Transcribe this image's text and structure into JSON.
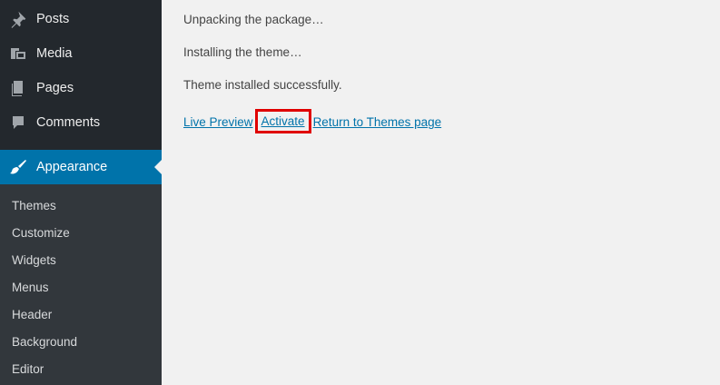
{
  "sidebar": {
    "items": [
      {
        "label": "Posts",
        "icon": "pin-icon"
      },
      {
        "label": "Media",
        "icon": "media-icon"
      },
      {
        "label": "Pages",
        "icon": "pages-icon"
      },
      {
        "label": "Comments",
        "icon": "comment-icon"
      },
      {
        "label": "Appearance",
        "icon": "brush-icon",
        "active": true
      }
    ],
    "submenu": [
      "Themes",
      "Customize",
      "Widgets",
      "Menus",
      "Header",
      "Background",
      "Editor"
    ],
    "colors": {
      "bg": "#23282d",
      "active": "#0073aa",
      "submenu_bg": "#32373c"
    }
  },
  "main": {
    "messages": [
      "Unpacking the package…",
      "Installing the theme…",
      "Theme installed successfully."
    ],
    "links": {
      "live_preview": "Live Preview",
      "activate": "Activate",
      "return": "Return to Themes page"
    },
    "highlight_color": "#e00000"
  }
}
